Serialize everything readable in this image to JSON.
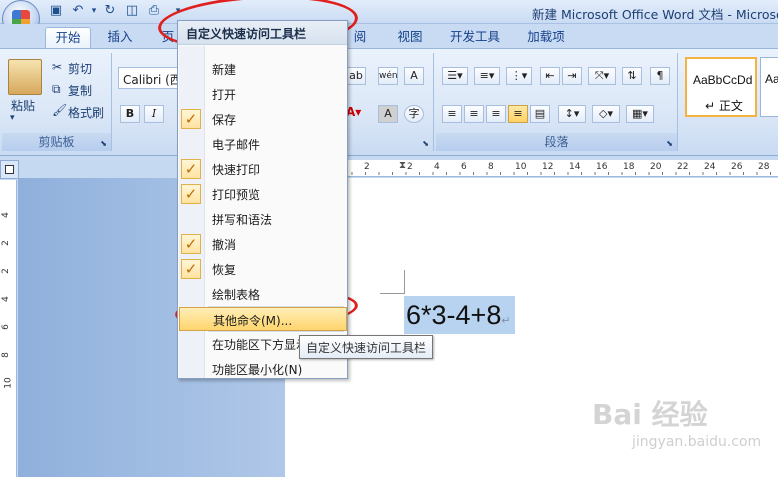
{
  "window": {
    "title": "新建 Microsoft Office Word 文档 - Microso"
  },
  "quick_access": {
    "icons": [
      "save-icon",
      "undo-icon",
      "redo-icon",
      "print-preview-icon",
      "quick-print-icon",
      "customize-dropdown-icon"
    ]
  },
  "tabs": [
    {
      "label": "开始",
      "active": true
    },
    {
      "label": "插入"
    },
    {
      "label": "页"
    },
    {
      "label": "阅"
    },
    {
      "label": "视图"
    },
    {
      "label": "开发工具"
    },
    {
      "label": "加载项"
    }
  ],
  "ribbon": {
    "clipboard": {
      "paste_label": "粘贴",
      "cut_label": "剪切",
      "copy_label": "复制",
      "format_painter_label": "格式刷",
      "group_label": "剪贴板"
    },
    "font": {
      "font_name": "Calibri (西",
      "bold": "B",
      "italic": "I"
    },
    "paragraph": {
      "group_label": "段落"
    },
    "styles": {
      "normal_preview": "AaBbCcDd",
      "normal_label": "↵ 正文",
      "next_preview": "Aa"
    }
  },
  "ruler": {
    "ticks": [
      "4",
      "2",
      "2",
      "4",
      "6",
      "8",
      "10",
      "12",
      "14",
      "16",
      "18",
      "20",
      "22",
      "24",
      "26",
      "28",
      "30",
      "32"
    ]
  },
  "vruler": {
    "ticks": [
      "4",
      "2",
      "2",
      "4",
      "6",
      "8",
      "10"
    ]
  },
  "document": {
    "text": "6*3-4+8",
    "para_mark": "↵"
  },
  "menu": {
    "header": "自定义快速访问工具栏",
    "items": [
      {
        "label": "新建",
        "checked": false
      },
      {
        "label": "打开",
        "checked": false
      },
      {
        "label": "保存",
        "checked": true
      },
      {
        "label": "电子邮件",
        "checked": false
      },
      {
        "label": "快速打印",
        "checked": true
      },
      {
        "label": "打印预览",
        "checked": true
      },
      {
        "label": "拼写和语法",
        "checked": false
      },
      {
        "label": "撤消",
        "checked": true
      },
      {
        "label": "恢复",
        "checked": true
      },
      {
        "label": "绘制表格",
        "checked": false
      },
      {
        "label": "其他命令(M)...",
        "checked": false,
        "hover": true
      },
      {
        "label": "在功能区下方显示(S)",
        "checked": false
      },
      {
        "label": "功能区最小化(N)",
        "checked": false
      }
    ],
    "check_glyph": "✓"
  },
  "tooltip": {
    "text": "自定义快速访问工具栏"
  },
  "watermark": {
    "text": "Bai 经验",
    "sub": "jingyan.baidu.com"
  },
  "colors": {
    "annotation": "#e0201e",
    "selection": "#b8d3ef",
    "menu_hover": "#ffd56d"
  }
}
